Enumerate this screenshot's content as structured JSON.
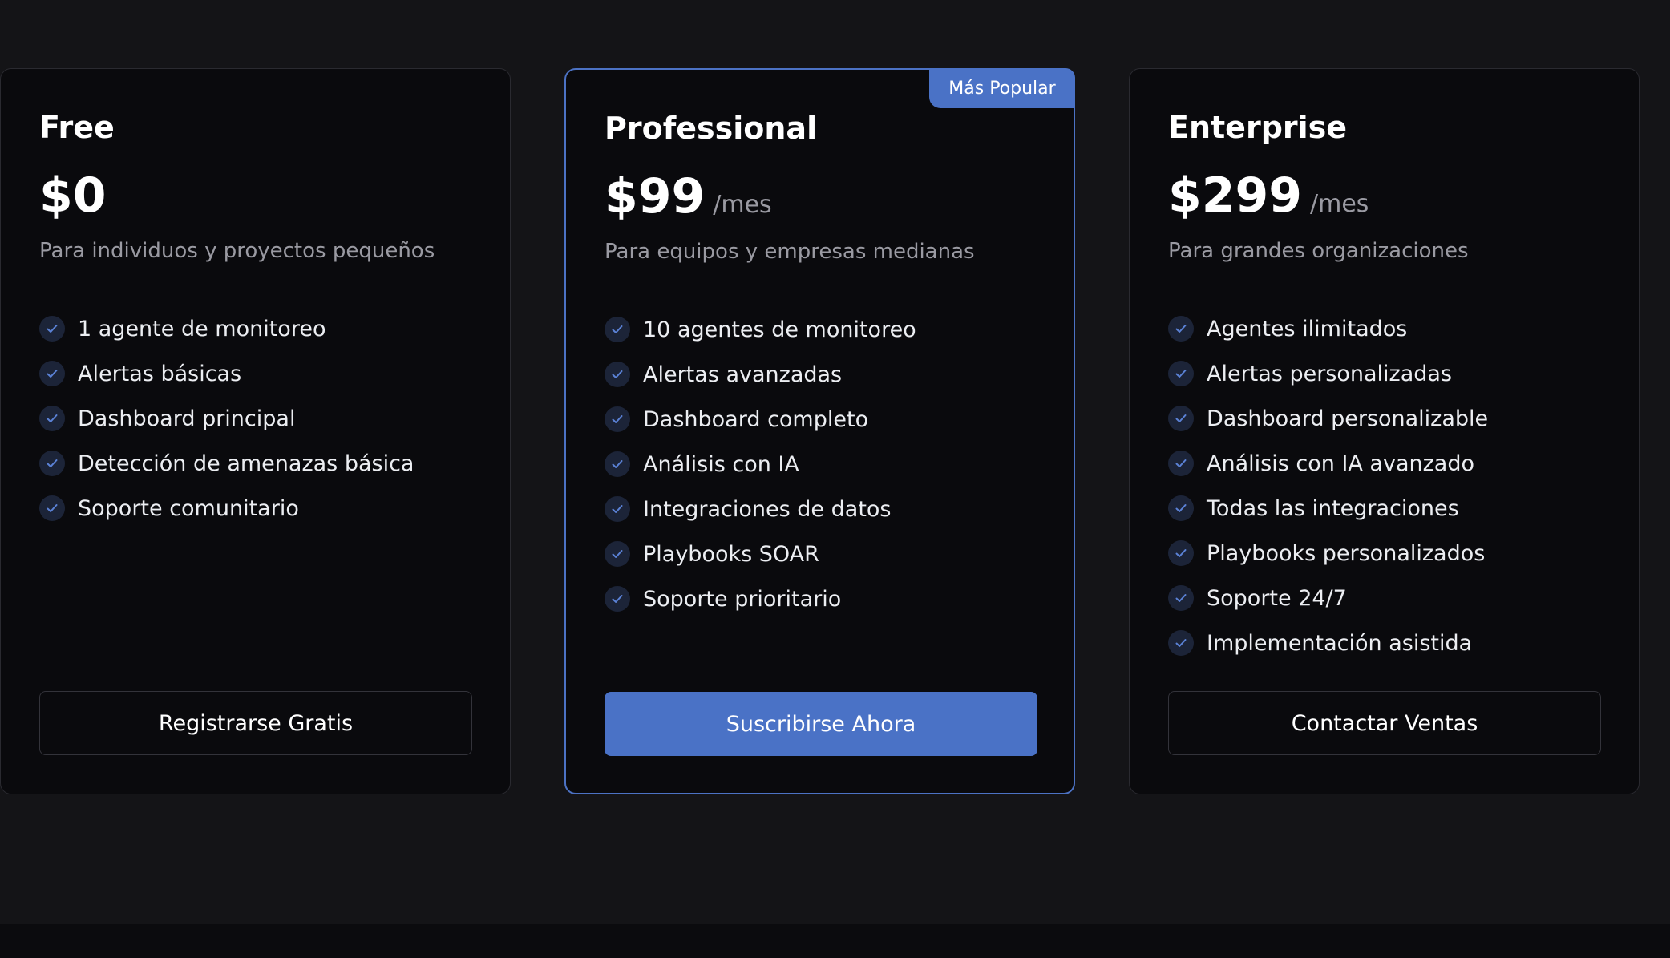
{
  "plans": [
    {
      "name": "Free",
      "price": "$0",
      "period": "",
      "description": "Para individuos y proyectos pequeños",
      "features": [
        "1 agente de monitoreo",
        "Alertas básicas",
        "Dashboard principal",
        "Detección de amenazas básica",
        "Soporte comunitario"
      ],
      "cta": "Registrarse Gratis"
    },
    {
      "name": "Professional",
      "price": "$99",
      "period": "/mes",
      "badge": "Más Popular",
      "description": "Para equipos y empresas medianas",
      "features": [
        "10 agentes de monitoreo",
        "Alertas avanzadas",
        "Dashboard completo",
        "Análisis con IA",
        "Integraciones de datos",
        "Playbooks SOAR",
        "Soporte prioritario"
      ],
      "cta": "Suscribirse Ahora"
    },
    {
      "name": "Enterprise",
      "price": "$299",
      "period": "/mes",
      "description": "Para grandes organizaciones",
      "features": [
        "Agentes ilimitados",
        "Alertas personalizadas",
        "Dashboard personalizable",
        "Análisis con IA avanzado",
        "Todas las integraciones",
        "Playbooks personalizados",
        "Soporte 24/7",
        "Implementación asistida"
      ],
      "cta": "Contactar Ventas"
    }
  ],
  "icons": {
    "feature": "check-icon"
  },
  "colors": {
    "accent": "#4a72c6",
    "check": "#5b82d6",
    "background": "#141417",
    "card": "#0a0a0d"
  }
}
